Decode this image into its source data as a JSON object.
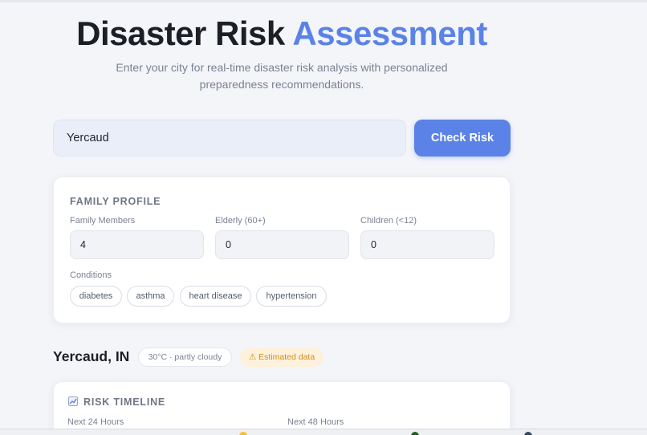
{
  "header": {
    "title_main": "Disaster Risk",
    "title_accent": "Assessment",
    "subtitle": "Enter your city for real-time disaster risk analysis with personalized preparedness recommendations."
  },
  "search": {
    "value": "Yercaud",
    "button_label": "Check Risk"
  },
  "family_profile": {
    "heading": "FAMILY PROFILE",
    "fields": [
      {
        "label": "Family Members",
        "value": "4"
      },
      {
        "label": "Elderly (60+)",
        "value": "0"
      },
      {
        "label": "Children (<12)",
        "value": "0"
      }
    ],
    "conditions_label": "Conditions",
    "conditions": [
      "diabetes",
      "asthma",
      "heart disease",
      "hypertension"
    ]
  },
  "location": {
    "name": "Yercaud, IN",
    "weather": "30°C · partly cloudy",
    "estimate_badge": "⚠ Estimated data"
  },
  "risk_timeline": {
    "heading": "RISK TIMELINE",
    "icon": "chart-increasing-icon",
    "horizons": [
      "Next 24 Hours",
      "Next 48 Hours"
    ]
  },
  "colors": {
    "accent": "#5b82e6",
    "background": "#f3f5f9",
    "warning_bg": "#fdf1dc",
    "warning_text": "#d38b1a"
  }
}
